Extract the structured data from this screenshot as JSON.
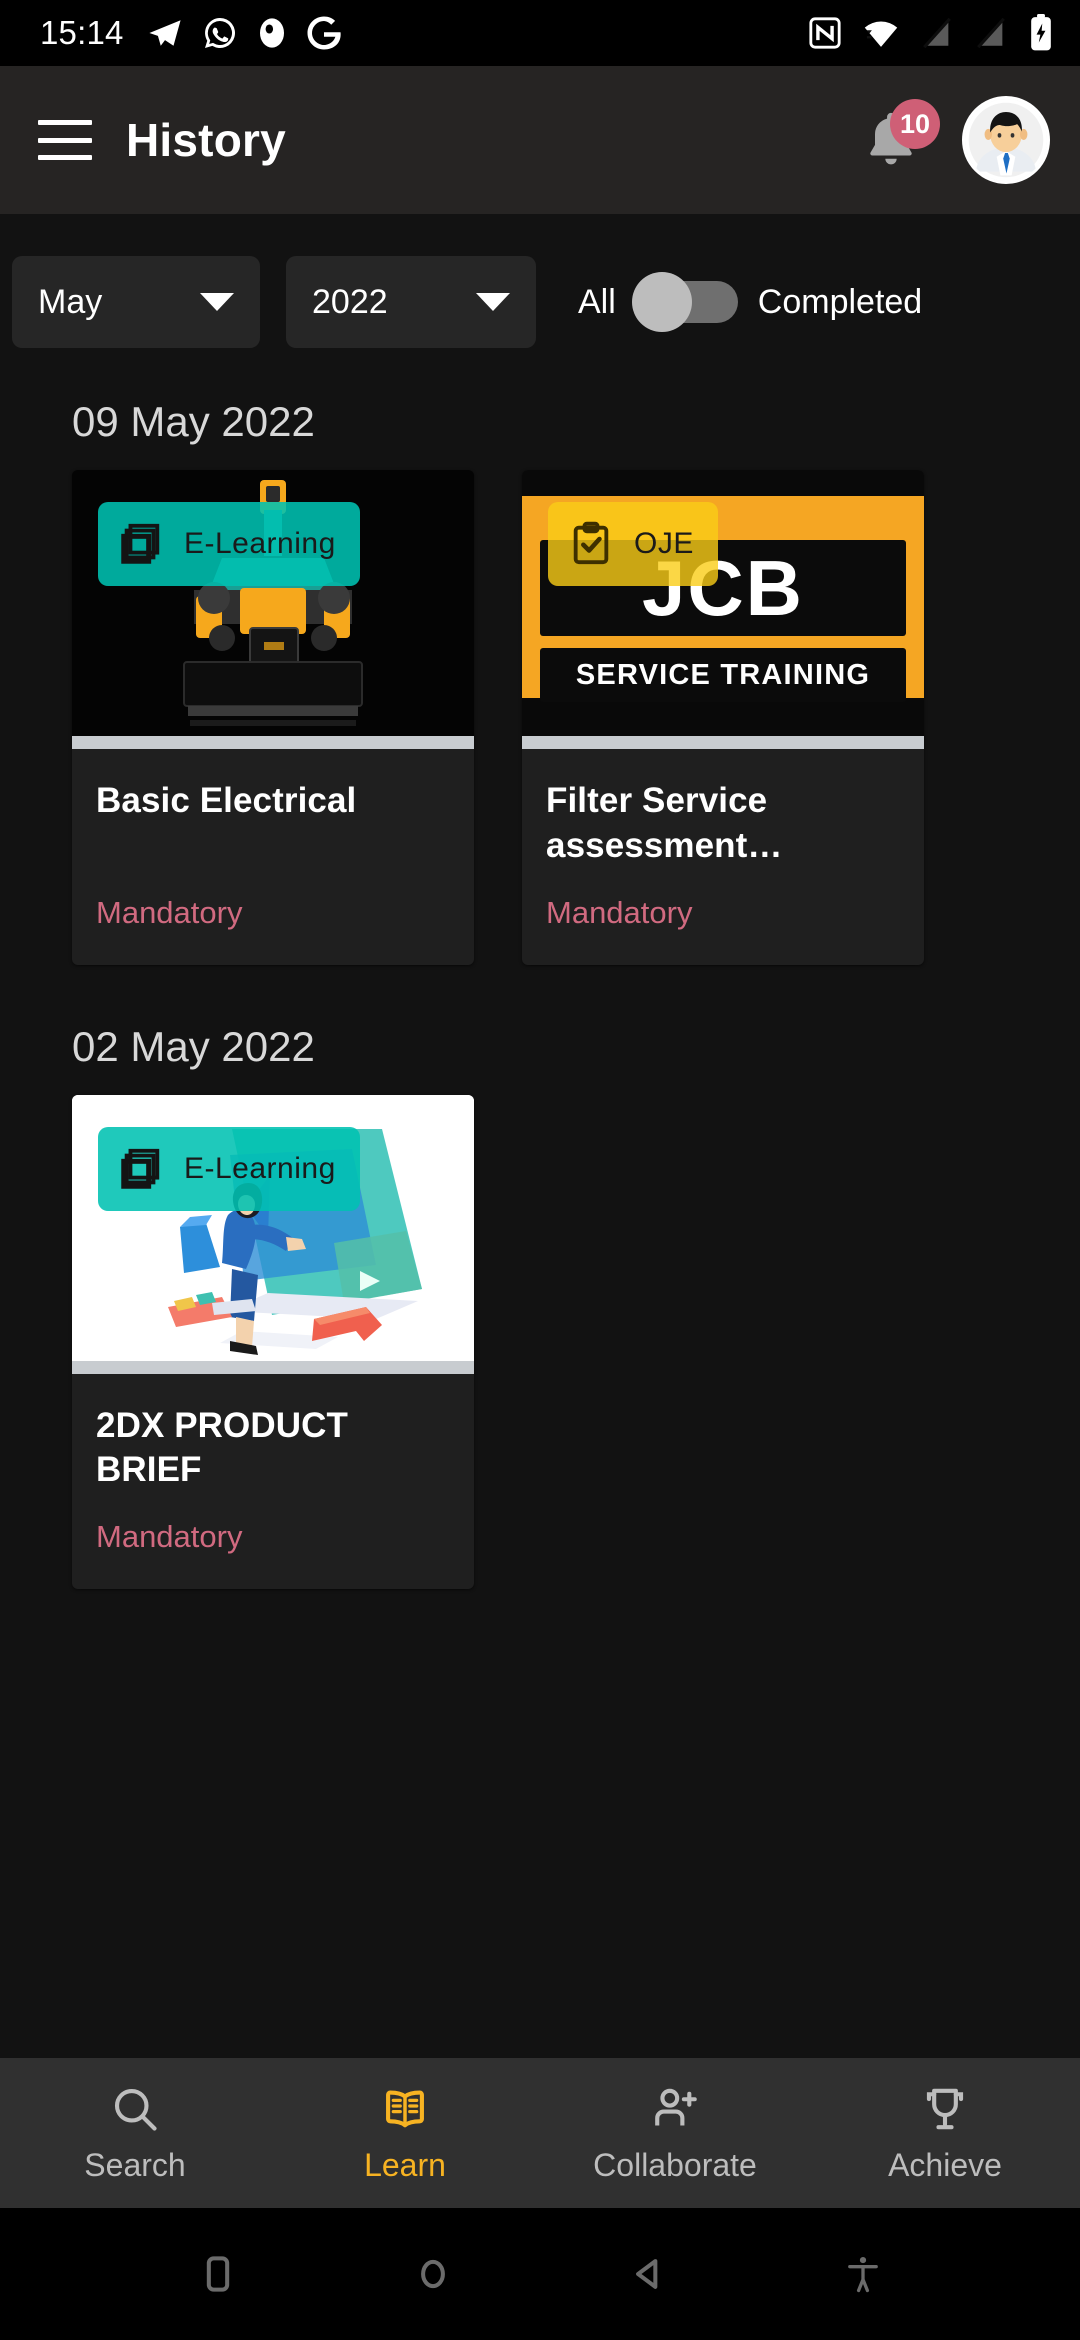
{
  "status_bar": {
    "time": "15:14",
    "left_icons": [
      "telegram-icon",
      "whatsapp-icon",
      "app-icon",
      "google-icon"
    ],
    "right_icons": [
      "nfc-icon",
      "wifi-icon",
      "signal-off-icon",
      "signal-off-icon",
      "battery-charging-icon"
    ]
  },
  "app_bar": {
    "menu_icon": "hamburger-menu-icon",
    "title": "History",
    "notification_icon": "bell-icon",
    "notification_count": "10",
    "avatar": "user-avatar"
  },
  "filters": {
    "month": {
      "value": "May",
      "icon": "chevron-down-icon"
    },
    "year": {
      "value": "2022",
      "icon": "chevron-down-icon"
    },
    "toggle": {
      "left_label": "All",
      "right_label": "Completed",
      "state": "all"
    }
  },
  "sections": [
    {
      "date": "09 May 2022",
      "cards": [
        {
          "type_label": "E-Learning",
          "type_icon": "layers-icon",
          "title": "Basic Electrical",
          "tag": "Mandatory",
          "thumb": "excavator-photo"
        },
        {
          "type_label": "OJE",
          "type_icon": "clipboard-check-icon",
          "title": "Filter Service assessment…",
          "tag": "Mandatory",
          "thumb": "jcb-service-training-logo",
          "logo_word": "JCB",
          "logo_sub": "SERVICE TRAINING"
        }
      ]
    },
    {
      "date": "02 May 2022",
      "cards": [
        {
          "type_label": "E-Learning",
          "type_icon": "layers-icon",
          "title": "2DX PRODUCT BRIEF",
          "tag": "Mandatory",
          "thumb": "isometric-elearning-illustration"
        }
      ]
    }
  ],
  "bottom_nav": [
    {
      "label": "Search",
      "icon": "search-icon",
      "active": false
    },
    {
      "label": "Learn",
      "icon": "book-icon",
      "active": true
    },
    {
      "label": "Collaborate",
      "icon": "person-add-icon",
      "active": false
    },
    {
      "label": "Achieve",
      "icon": "trophy-icon",
      "active": false
    }
  ],
  "android_nav": [
    "recents-icon",
    "home-icon",
    "back-icon",
    "accessibility-icon"
  ],
  "colors": {
    "accent": "#f7b322",
    "elearning_badge": "#00c1b2",
    "oje_badge": "#facd16",
    "mandatory": "#d16a80",
    "notification_badge": "#cf5f76",
    "background": "#121212",
    "appbar": "#262423",
    "card": "#1f1f1f"
  }
}
